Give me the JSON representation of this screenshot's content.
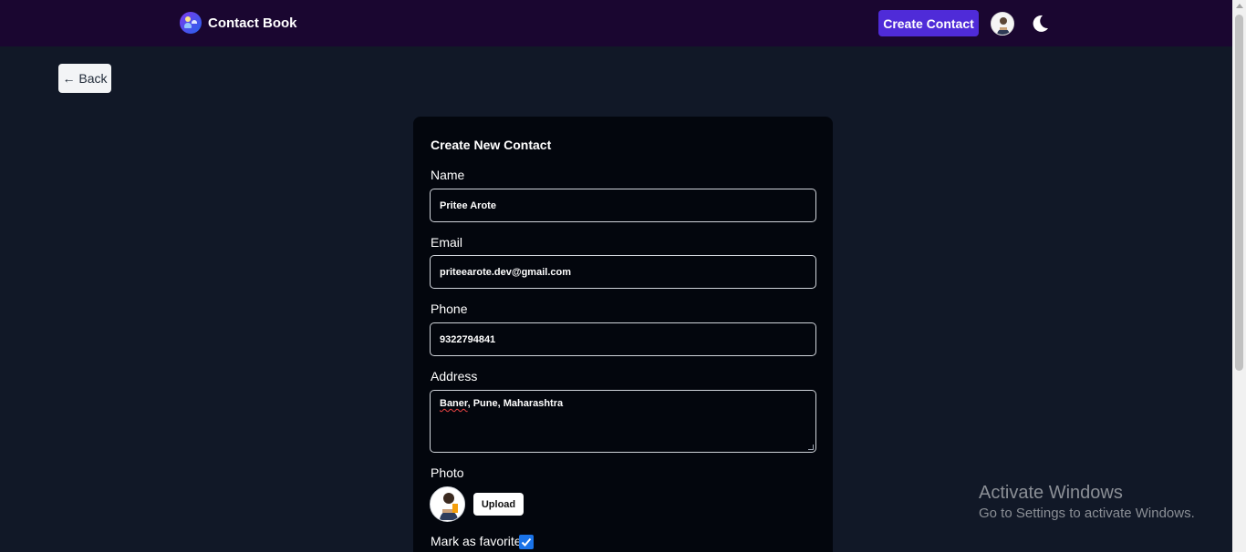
{
  "header": {
    "brand_title": "Contact Book",
    "create_button": "Create Contact",
    "avatar_icon": "user-avatar-icon",
    "theme_icon": "moon-icon"
  },
  "back_button": "← Back",
  "form": {
    "title": "Create New Contact",
    "name": {
      "label": "Name",
      "value": "Pritee Arote"
    },
    "email": {
      "label": "Email",
      "value": "priteearote.dev@gmail.com"
    },
    "phone": {
      "label": "Phone",
      "value": "9322794841"
    },
    "address": {
      "label": "Address",
      "value_misspelled": "Baner",
      "value_rest": ", Pune, Maharashtra"
    },
    "photo": {
      "label": "Photo",
      "upload_button": "Upload"
    },
    "favorite": {
      "label": "Mark as favorite",
      "checked": true
    }
  },
  "watermark": {
    "title": "Activate Windows",
    "subtitle": "Go to Settings to activate Windows."
  },
  "colors": {
    "background": "#111827",
    "topbar": "#1a0630",
    "accent": "#4f2bd8",
    "card": "#03060d",
    "checkbox": "#1a73e8"
  }
}
